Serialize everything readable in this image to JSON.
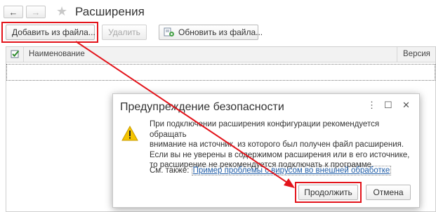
{
  "window": {
    "title": "Расширения",
    "back_icon": "←",
    "forward_icon": "→",
    "favorite_icon": "★"
  },
  "toolbar": {
    "add_from_file": "Добавить из файла...",
    "delete": "Удалить",
    "update_from_file": "Обновить из файла..."
  },
  "table": {
    "columns": [
      "Наименование",
      "Версия"
    ]
  },
  "dialog": {
    "title": "Предупреждение безопасности",
    "menu_icon": "⋮",
    "maximize_icon": "☐",
    "close_icon": "✕",
    "message_lines": [
      "При подключении расширения конфигурации рекомендуется обращать",
      "внимание на источник, из которого был получен файл расширения.",
      "Если вы не уверены в содержимом расширения или в его источнике,",
      "то расширение не рекомендуется подключать к программе."
    ],
    "see_also_label": "См. также:",
    "see_also_link": "Пример проблемы с вирусом во внешней обработке",
    "continue_label": "Продолжить",
    "cancel_label": "Отмена"
  },
  "annotations": {
    "highlight_color": "#e3141b"
  }
}
